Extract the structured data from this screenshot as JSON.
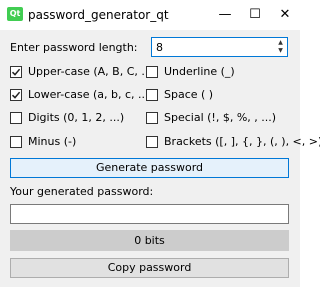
{
  "window": {
    "title": "password_generator_qt",
    "icon": "qt-logo-icon",
    "icon_text": "Qt"
  },
  "controls": {
    "minimize": "—",
    "maximize": "☐",
    "close": "✕"
  },
  "length": {
    "label": "Enter password length:",
    "value": "8"
  },
  "options": {
    "uppercase": {
      "label": "Upper-case (A, B, C, ...)",
      "checked": true
    },
    "underline": {
      "label": "Underline (_)",
      "checked": false
    },
    "lowercase": {
      "label": "Lower-case (a, b, c, ...)",
      "checked": true
    },
    "space": {
      "label": "Space ( )",
      "checked": false
    },
    "digits": {
      "label": "Digits (0, 1, 2, ...)",
      "checked": false
    },
    "special": {
      "label": "Special (!, $, %, , ...)",
      "checked": false
    },
    "minus": {
      "label": "Minus (-)",
      "checked": false
    },
    "brackets": {
      "label": "Brackets ([, ], {, }, (, ), <, >)",
      "checked": false
    }
  },
  "generate_button": "Generate password",
  "output": {
    "label": "Your generated password:",
    "value": ""
  },
  "strength": {
    "text": "0 bits"
  },
  "copy_button": "Copy password",
  "colors": {
    "accent": "#0078d7",
    "qt_green": "#41cd52",
    "progress_bg": "#cccccc"
  }
}
